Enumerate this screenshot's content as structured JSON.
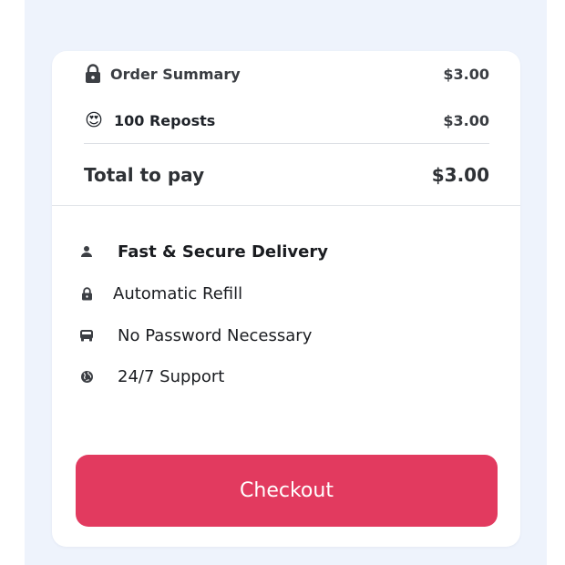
{
  "colors": {
    "backdrop": "#eef3fc",
    "card": "#ffffff",
    "checkout_button": "#e23a5f",
    "icon": "#3c3f44"
  },
  "summary": {
    "title": "Order Summary",
    "title_price": "$3.00",
    "title_icon": "lock-icon"
  },
  "item": {
    "emoji": "😍",
    "emoji_icon": "heart-eyes-emoji-icon",
    "label": "100 Reposts",
    "price": "$3.00"
  },
  "total": {
    "label": "Total to pay",
    "value": "$3.00"
  },
  "features": [
    {
      "label": "Fast & Secure Delivery",
      "icon": "user-icon"
    },
    {
      "label": "Automatic Refill",
      "icon": "lock-icon"
    },
    {
      "label": "No Password Necessary",
      "icon": "car-icon"
    },
    {
      "label": "24/7 Support",
      "icon": "globe-icon"
    }
  ],
  "checkout": {
    "label": "Checkout"
  }
}
